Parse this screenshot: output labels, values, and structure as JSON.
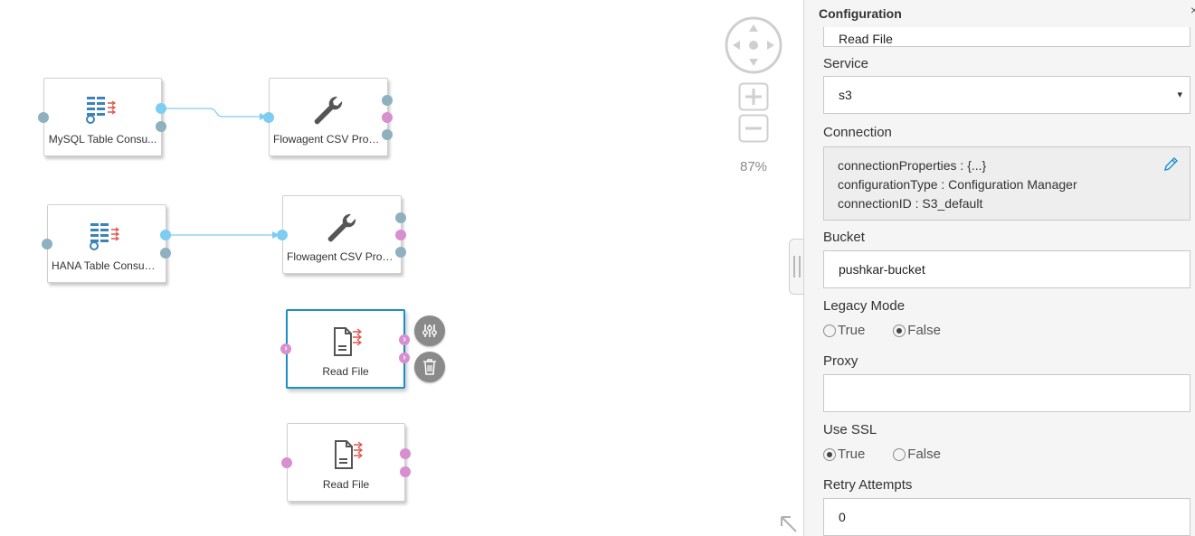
{
  "graph": {
    "nodes": [
      {
        "id": "mysql",
        "label": "MySQL Table Consu...",
        "icon": "table-consumer-icon"
      },
      {
        "id": "csv1",
        "label": "Flowagent CSV Prod...",
        "icon": "wrench-icon"
      },
      {
        "id": "hana",
        "label": "HANA Table Consumer",
        "icon": "table-consumer-icon"
      },
      {
        "id": "csv2",
        "label": "Flowagent CSV Prod...",
        "icon": "wrench-icon"
      },
      {
        "id": "readfile1",
        "label": "Read File",
        "icon": "file-reader-icon",
        "selected": true
      },
      {
        "id": "readfile2",
        "label": "Read File",
        "icon": "file-reader-icon"
      }
    ],
    "node_actions": [
      "settings-icon",
      "trash-icon"
    ]
  },
  "navigation": {
    "zoom_level": "87%"
  },
  "panel": {
    "title": "Configuration",
    "close_glyph": "×",
    "top_field_value": "Read File",
    "service": {
      "label": "Service",
      "value": "s3",
      "caret": "▾"
    },
    "connection": {
      "label": "Connection",
      "lines": [
        "connectionProperties : {...}",
        "configurationType : Configuration Manager",
        "connectionID : S3_default"
      ]
    },
    "bucket": {
      "label": "Bucket",
      "value": "pushkar-bucket"
    },
    "legacy_mode": {
      "label": "Legacy Mode",
      "options": [
        "True",
        "False"
      ],
      "selected": "False"
    },
    "proxy": {
      "label": "Proxy",
      "value": ""
    },
    "use_ssl": {
      "label": "Use SSL",
      "options": [
        "True",
        "False"
      ],
      "selected": "True"
    },
    "retry_attempts": {
      "label": "Retry Attempts",
      "value": "0"
    }
  },
  "colors": {
    "accent": "#1b8fc8",
    "port_gray": "#8fb0bf",
    "port_blue": "#7dcdf2",
    "port_pink": "#d78fcf",
    "icon_blue": "#3b83b8",
    "icon_red": "#e0544a",
    "icon_dark": "#555555"
  }
}
